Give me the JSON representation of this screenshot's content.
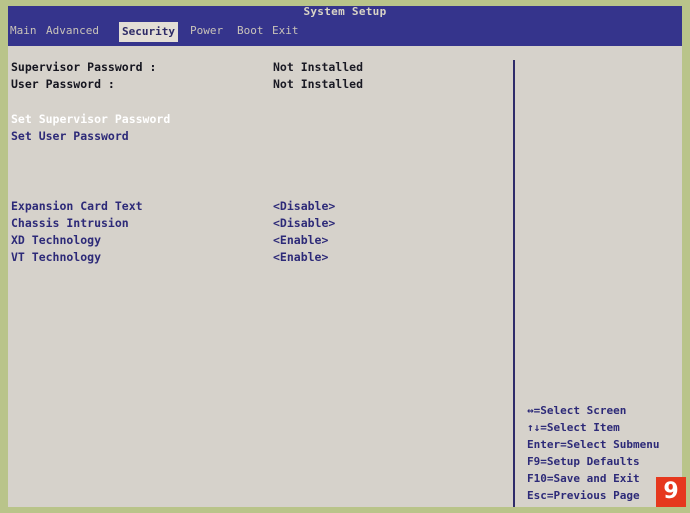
{
  "app": {
    "title": "System Setup"
  },
  "menu": {
    "tabs": [
      {
        "label": "Main"
      },
      {
        "label": "Advanced"
      },
      {
        "label": "Security"
      },
      {
        "label": "Power"
      },
      {
        "label": "Boot"
      },
      {
        "label": "Exit"
      }
    ],
    "active_tab": "Security"
  },
  "security": {
    "status": [
      {
        "label": "Supervisor Password :",
        "value": "Not Installed"
      },
      {
        "label": "User Password :",
        "value": "Not Installed"
      }
    ],
    "actions": [
      {
        "label": "Set Supervisor Password"
      },
      {
        "label": "Set User Password"
      }
    ],
    "options": [
      {
        "label": "Expansion Card Text",
        "value": "<Disable>"
      },
      {
        "label": "Chassis Intrusion",
        "value": "<Disable>"
      },
      {
        "label": "XD Technology",
        "value": "<Enable>"
      },
      {
        "label": "VT Technology",
        "value": "<Enable>"
      }
    ]
  },
  "help": {
    "items": [
      "↔=Select Screen",
      "↑↓=Select Item",
      "Enter=Select Submenu",
      "F9=Setup Defaults",
      "F10=Save and Exit",
      "Esc=Previous Page"
    ]
  },
  "badge": {
    "text": "9"
  },
  "colors": {
    "menu_bg": "#35348c",
    "panel_bg": "#d6d2cb",
    "text_blue": "#2d2a78",
    "outer_bg": "#b9c48a",
    "badge": "#e6381e"
  }
}
